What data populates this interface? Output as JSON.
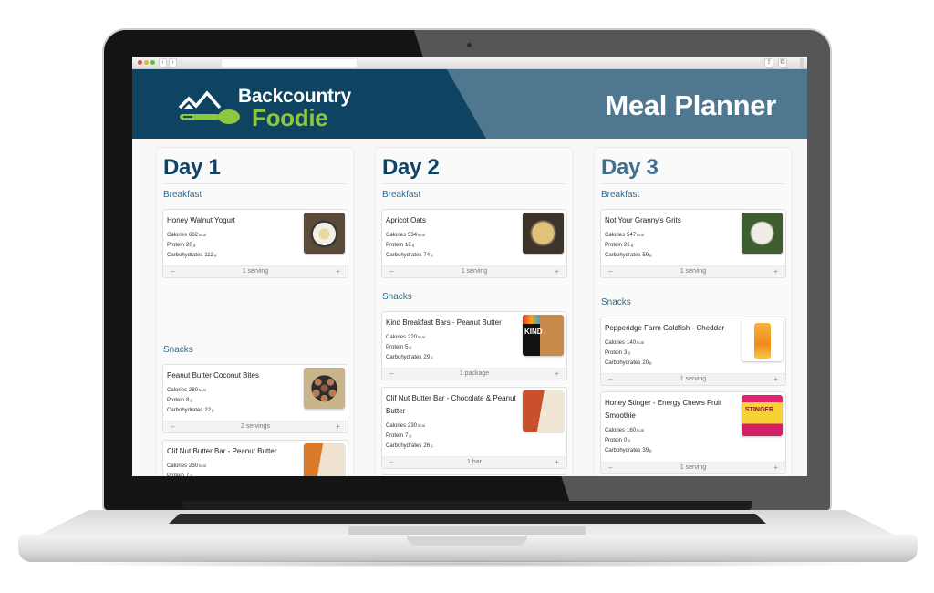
{
  "browser": {
    "back_icon": "‹",
    "forward_icon": "›",
    "url": "",
    "share_icon": "⇧",
    "tabs_icon": "⧉"
  },
  "header": {
    "logo_line1": "Backcountry",
    "logo_line2": "Foodie",
    "title": "Meal Planner",
    "colors": {
      "primary": "#0e4461",
      "secondary": "#4f7890",
      "accent": "#8dc63f"
    }
  },
  "days": [
    {
      "title": "Day 1",
      "meals": [
        {
          "label": "Breakfast",
          "items": [
            {
              "name": "Honey Walnut Yogurt",
              "calories": "662",
              "calories_unit": "kcal",
              "protein": "20",
              "protein_unit": "g",
              "carbs": "112",
              "carbs_unit": "g",
              "quantity": "1 serving",
              "image": "yogurt-bowl"
            }
          ]
        },
        {
          "label": "Snacks",
          "items": [
            {
              "name": "Peanut Butter Coconut Bites",
              "calories": "280",
              "calories_unit": "kcal",
              "protein": "8",
              "protein_unit": "g",
              "carbs": "22",
              "carbs_unit": "g",
              "quantity": "2 servings",
              "image": "pb-coconut-bites"
            },
            {
              "name": "Clif Nut Butter Bar - Peanut Butter",
              "calories": "230",
              "calories_unit": "kcal",
              "protein": "7",
              "protein_unit": "g",
              "image": "clif-bar-peanut-butter"
            }
          ]
        }
      ]
    },
    {
      "title": "Day 2",
      "meals": [
        {
          "label": "Breakfast",
          "items": [
            {
              "name": "Apricot Oats",
              "calories": "534",
              "calories_unit": "kcal",
              "protein": "18",
              "protein_unit": "g",
              "carbs": "74",
              "carbs_unit": "g",
              "quantity": "1 serving",
              "image": "apricot-oats"
            }
          ]
        },
        {
          "label": "Snacks",
          "items": [
            {
              "name": "Kind Breakfast Bars - Peanut Butter",
              "calories": "220",
              "calories_unit": "kcal",
              "protein": "5",
              "protein_unit": "g",
              "carbs": "29",
              "carbs_unit": "g",
              "quantity": "1 package",
              "image": "kind-bar",
              "image_text": "KIND"
            },
            {
              "name": "Clif Nut Butter Bar - Chocolate & Peanut Butter",
              "calories": "230",
              "calories_unit": "kcal",
              "protein": "7",
              "protein_unit": "g",
              "carbs": "26",
              "carbs_unit": "g",
              "quantity": "1 bar",
              "image": "clif-bar-chocolate"
            }
          ]
        }
      ]
    },
    {
      "title": "Day 3",
      "meals": [
        {
          "label": "Breakfast",
          "items": [
            {
              "name": "Not Your Granny's Grits",
              "calories": "547",
              "calories_unit": "kcal",
              "protein": "26",
              "protein_unit": "g",
              "carbs": "59",
              "carbs_unit": "g",
              "quantity": "1 serving",
              "image": "grits-bowl"
            }
          ]
        },
        {
          "label": "Snacks",
          "items": [
            {
              "name": "Pepperidge Farm Goldfish - Cheddar",
              "calories": "140",
              "calories_unit": "kcal",
              "protein": "3",
              "protein_unit": "g",
              "carbs": "20",
              "carbs_unit": "g",
              "quantity": "1 serving",
              "image": "goldfish-bag"
            },
            {
              "name": "Honey Stinger - Energy Chews Fruit Smoothie",
              "calories": "160",
              "calories_unit": "kcal",
              "protein": "0",
              "protein_unit": "g",
              "carbs": "39",
              "carbs_unit": "g",
              "quantity": "1 serving",
              "image": "honey-stinger-pack",
              "image_text": "STINGER"
            }
          ]
        }
      ]
    }
  ],
  "labels": {
    "calories": "Calories",
    "protein": "Protein",
    "carbs": "Carbohydrates",
    "minus": "–",
    "plus": "+"
  }
}
